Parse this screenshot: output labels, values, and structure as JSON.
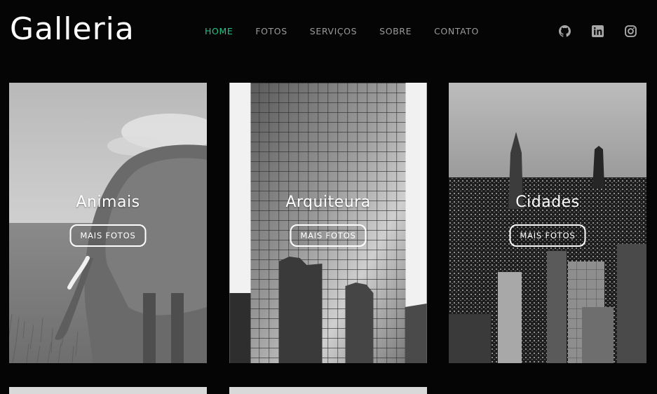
{
  "brand": {
    "logo": "Galleria"
  },
  "nav": [
    {
      "label": "HOME",
      "active": true
    },
    {
      "label": "FOTOS",
      "active": false
    },
    {
      "label": "SERVIÇOS",
      "active": false
    },
    {
      "label": "SOBRE",
      "active": false
    },
    {
      "label": "CONTATO",
      "active": false
    }
  ],
  "social": [
    "github-icon",
    "linkedin-icon",
    "instagram-icon"
  ],
  "colors": {
    "accent": "#22c48a",
    "background": "#050505",
    "nav_text": "#9a9a9a"
  },
  "cards": [
    {
      "title": "Animais",
      "button": "MAIS FOTOS"
    },
    {
      "title": "Arquiteura",
      "button": "MAIS FOTOS"
    },
    {
      "title": "Cidades",
      "button": "MAIS FOTOS"
    }
  ]
}
